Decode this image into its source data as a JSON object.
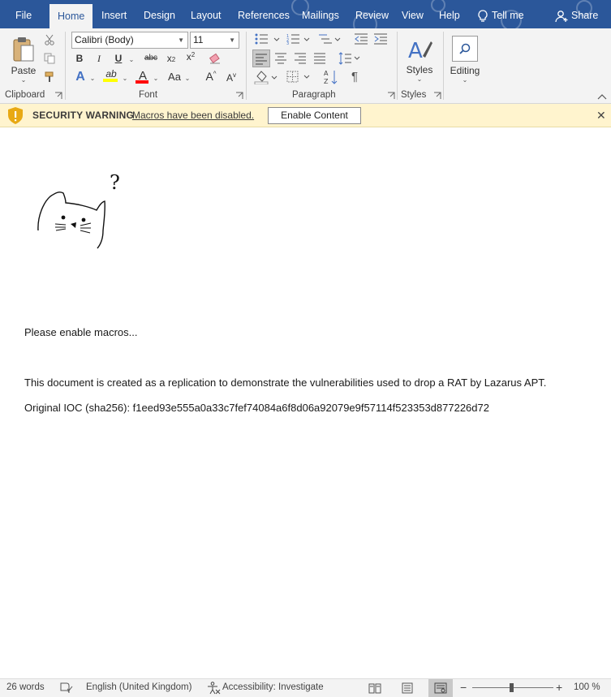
{
  "tabs": {
    "file": "File",
    "home": "Home",
    "insert": "Insert",
    "design": "Design",
    "layout": "Layout",
    "references": "References",
    "mailings": "Mailings",
    "review": "Review",
    "view": "View",
    "help": "Help",
    "tell_me": "Tell me",
    "share": "Share"
  },
  "ribbon": {
    "clipboard": {
      "label": "Clipboard",
      "paste": "Paste"
    },
    "font": {
      "label": "Font",
      "font_name": "Calibri (Body)",
      "font_size": "11",
      "bold": "B",
      "italic": "I",
      "underline": "U",
      "strikethrough": "abc",
      "subscript": "x",
      "superscript": "x",
      "change_case": "Aa",
      "grow": "A",
      "shrink": "A",
      "text_effects": "A",
      "font_color": "A",
      "highlight": "ab"
    },
    "paragraph": {
      "label": "Paragraph",
      "pilcrow": "¶"
    },
    "styles": {
      "label": "Styles",
      "button": "Styles"
    },
    "editing": {
      "button": "Editing"
    }
  },
  "security_bar": {
    "title": "SECURITY WARNING",
    "message": "Macros have been disabled.",
    "enable_button": "Enable Content",
    "close": "✕"
  },
  "document": {
    "doodle_text": "?",
    "lines": [
      "Please enable macros...",
      "This document is created as a replication to demonstrate the vulnerabilities used to drop a RAT by Lazarus APT.",
      "Original IOC (sha256): f1eed93e555a0a33c7fef74084a6f8d06a92079e9f57114f523353d877226d72"
    ]
  },
  "status_bar": {
    "word_count": "26 words",
    "language": "English (United Kingdom)",
    "accessibility": "Accessibility: Investigate",
    "zoom_minus": "−",
    "zoom_plus": "+",
    "zoom": "100 %",
    "zoom_level": 1.0
  },
  "colors": {
    "title_blue": "#2b579a",
    "ribbon_bg": "#f3f3f3",
    "warning_bg": "#fff4ce",
    "highlight_yellow": "#ffff00",
    "font_red": "#ff0000"
  },
  "icons": {
    "paste": "clipboard-paste-icon",
    "cut": "scissors-icon",
    "copy": "copy-icon",
    "format_painter": "paintbrush-icon",
    "bulb": "lightbulb-icon",
    "share": "person-add-icon",
    "shield": "shield-warning-icon",
    "styles": "styles-brush-icon",
    "editing": "search-icon"
  }
}
